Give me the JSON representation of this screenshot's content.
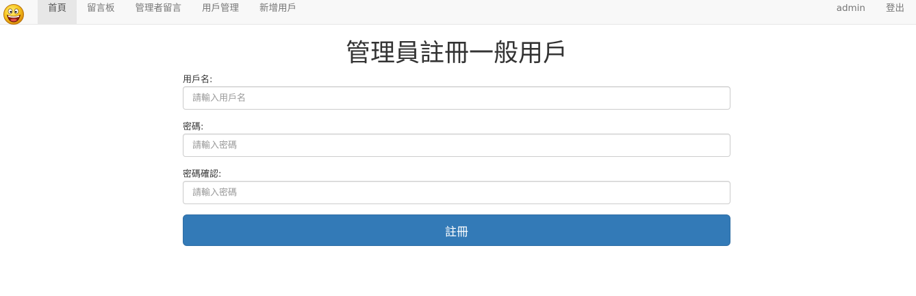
{
  "navbar": {
    "brand_icon": "smiley-face-icon",
    "left_items": [
      "首頁",
      "留言板",
      "管理者留言",
      "用戶管理",
      "新增用戶"
    ],
    "active_index": 0,
    "user": "admin",
    "logout": "登出",
    "background": "#f8f8f8",
    "active_background": "#e7e7e7"
  },
  "page": {
    "title": "管理員註冊一般用戶"
  },
  "form": {
    "username": {
      "label": "用戶名:",
      "placeholder": "請輸入用戶名",
      "value": ""
    },
    "password": {
      "label": "密碼:",
      "placeholder": "請輸入密碼",
      "value": ""
    },
    "confirm": {
      "label": "密碼確認:",
      "placeholder": "請輸入密碼",
      "value": ""
    },
    "submit_label": "註冊",
    "submit_color": "#337ab7"
  }
}
